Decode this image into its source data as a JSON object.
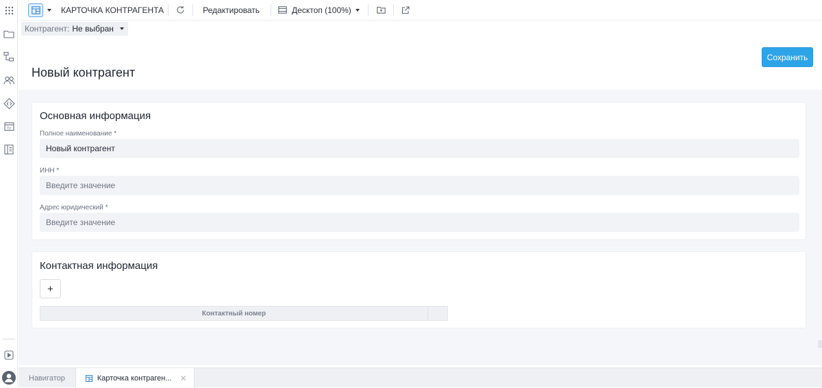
{
  "toolbar": {
    "page_name": "КАРТОЧКА КОНТРАГЕНТА",
    "edit_label": "Редактировать",
    "viewport_label": "Десктоп (100%)"
  },
  "filter": {
    "label": "Контрагент:",
    "value": "Не выбран"
  },
  "save_label": "Сохранить",
  "page_title": "Новый контрагент",
  "main_section": {
    "title": "Основная информация",
    "fields": [
      {
        "label": "Полное наименование *",
        "value": "Новый контрагент",
        "placeholder": ""
      },
      {
        "label": "ИНН *",
        "value": "",
        "placeholder": "Введите значение"
      },
      {
        "label": "Адрес юридический *",
        "value": "",
        "placeholder": "Введите значение"
      }
    ]
  },
  "contact_section": {
    "title": "Контактная информация",
    "add_label": "+",
    "columns": [
      "Контактный номер",
      ""
    ]
  },
  "bottom_tabs": [
    {
      "label": "Навигатор"
    },
    {
      "label": "Карточка контраген...",
      "close": "✕"
    }
  ],
  "icons": {
    "rail": [
      "apps-grid-icon",
      "folder-icon",
      "hierarchy-icon",
      "users-icon",
      "api-icon",
      "table-icon",
      "book-icon",
      "play-icon",
      "user-avatar-icon"
    ]
  }
}
